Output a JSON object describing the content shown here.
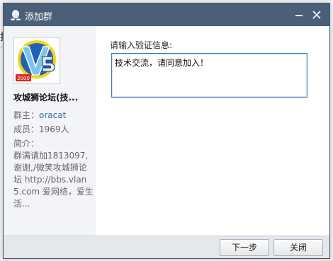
{
  "background_peek": {
    "text": "技"
  },
  "window": {
    "title": "添加群",
    "title_icon": "qq-penguin-icon",
    "controls": {
      "minimize": "minimize-icon",
      "close": "close-icon"
    }
  },
  "group": {
    "avatar_badge": "2000",
    "avatar_icon": "v5-logo",
    "name": "攻城狮论坛(技...",
    "owner_label": "群主：",
    "owner_value": "oracat",
    "members_label": "成员：",
    "members_value": "1969人",
    "intro_label": "简介：",
    "intro_text": "群满请加1813097,谢谢,/微笑攻城狮论坛 http://bbs.vlan5.com 爱网络，爱生活..."
  },
  "form": {
    "label": "请输入验证信息:",
    "message": "技术交流，请同意加入！"
  },
  "buttons": {
    "next": "下一步",
    "close": "关闭"
  },
  "colors": {
    "titlebar": "#4a6078",
    "link": "#2f6cb2",
    "input_border": "#3c7fc4"
  }
}
